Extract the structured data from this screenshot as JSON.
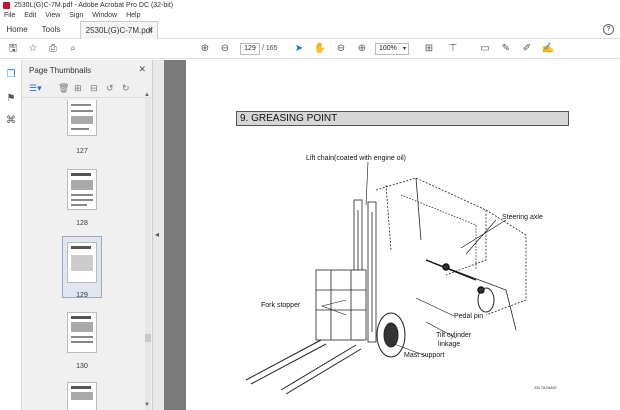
{
  "window": {
    "title": "2530L(G)C-7M.pdf - Adobe Acrobat Pro DC (32-bit)"
  },
  "menu": [
    "File",
    "Edit",
    "View",
    "Sign",
    "Window",
    "Help"
  ],
  "tabs": {
    "home": "Home",
    "tools": "Tools",
    "doc": "2530L(G)C-7M.pdf"
  },
  "toolbar": {
    "page_current": "129",
    "page_total": "/ 165",
    "zoom": "100%"
  },
  "panel": {
    "title": "Page Thumbnails",
    "thumbnails": [
      {
        "label": "127"
      },
      {
        "label": "128"
      },
      {
        "label": "129",
        "selected": true
      },
      {
        "label": "130"
      }
    ]
  },
  "document": {
    "section_title": "9. GREASING POINT",
    "callouts": {
      "lift_chain": "Lift chain(coated with engine oil)",
      "steering_axle": "Steering axle",
      "fork_stopper": "Fork stopper",
      "pedal_pin": "Pedal pin",
      "tilt_cylinder_1": "Tilt cylinder",
      "tilt_cylinder_2": "linkage",
      "mast_support": "Mast support"
    },
    "figure_id": "25L7AOM45"
  },
  "colors": {
    "accent": "#1473e6",
    "doc_background": "#7a7a7a",
    "brand": "#c8102e"
  }
}
